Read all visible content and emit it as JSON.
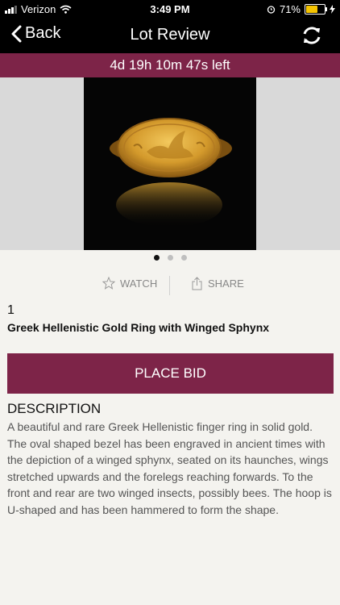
{
  "status": {
    "carrier": "Verizon",
    "time": "3:49 PM",
    "battery": "71%",
    "battery_level": 0.71
  },
  "nav": {
    "back_label": "Back",
    "title": "Lot Review",
    "back_icon": "chevron-left-icon",
    "refresh_icon": "refresh-icon"
  },
  "timer": {
    "text": "4d 19h 10m 47s left"
  },
  "gallery": {
    "count": 3,
    "active_index": 0
  },
  "actions": {
    "watch_label": "WATCH",
    "share_label": "SHARE"
  },
  "lot": {
    "number": "1",
    "title": "Greek Hellenistic Gold Ring with Winged Sphynx"
  },
  "bid": {
    "label": "PLACE BID"
  },
  "description": {
    "heading": "DESCRIPTION",
    "text": "A beautiful and rare Greek Hellenistic finger ring in solid gold. The oval shaped bezel has been engraved in ancient times with the depiction of a winged sphynx, seated on its haunches, wings stretched upwards and the forelegs reaching forwards. To the front and rear are two winged insects, possibly bees. The hoop is U-shaped and has been hammered to form the shape."
  },
  "colors": {
    "accent": "#7d2448",
    "background": "#f4f3ef",
    "bar": "#000000"
  }
}
